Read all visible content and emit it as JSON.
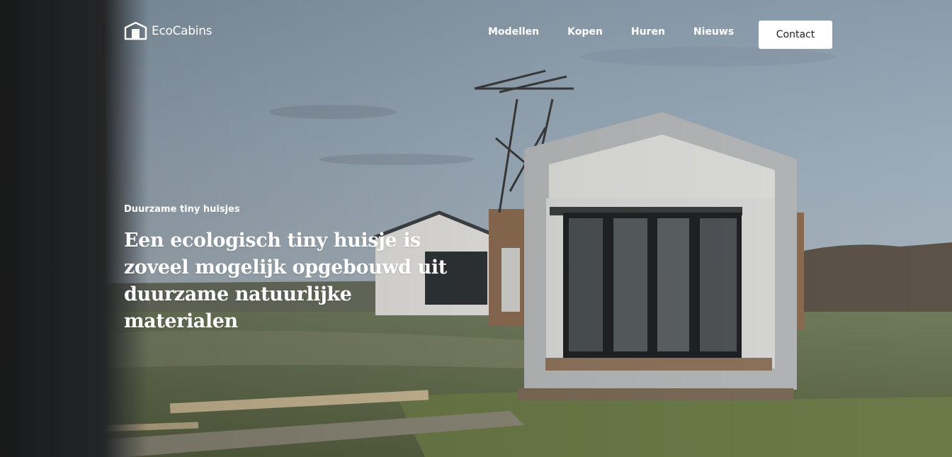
{
  "brand": {
    "name": "EcoCabins",
    "icon": "cabin-logo-icon"
  },
  "nav": {
    "items": [
      {
        "label": "Modellen"
      },
      {
        "label": "Kopen"
      },
      {
        "label": "Huren"
      },
      {
        "label": "Nieuws"
      }
    ],
    "cta_label": "Contact"
  },
  "hero": {
    "eyebrow": "Duurzame tiny huisjes",
    "headline": "Een ecologisch tiny huisje is zoveel mogelijk opgebouwd uit duurzame natuurlijke materialen",
    "image": "tiny-house-landscape-photo"
  },
  "colors": {
    "text_on_hero": "#ffffff",
    "button_bg": "#ffffff",
    "button_text": "#1f1f1f"
  }
}
